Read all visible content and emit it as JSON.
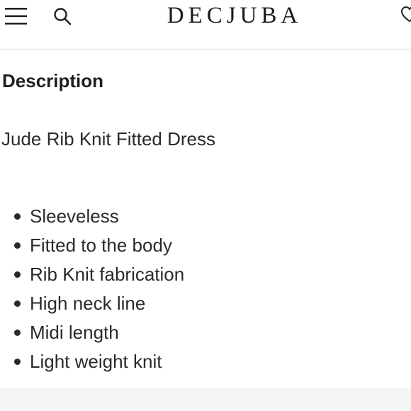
{
  "header": {
    "brand": "DECJUBA",
    "menu_icon": "hamburger-menu-icon",
    "search_icon": "search-icon",
    "wishlist_icon": "heart-icon"
  },
  "description": {
    "title": "Description",
    "product_name": "Jude Rib Knit Fitted Dress",
    "features": [
      "Sleeveless",
      "Fitted to the body",
      "Rib Knit fabrication",
      "High neck line",
      "Midi length",
      "Light weight knit"
    ]
  },
  "colors": {
    "text": "#2a2a2a",
    "divider": "#e6e6e6"
  }
}
